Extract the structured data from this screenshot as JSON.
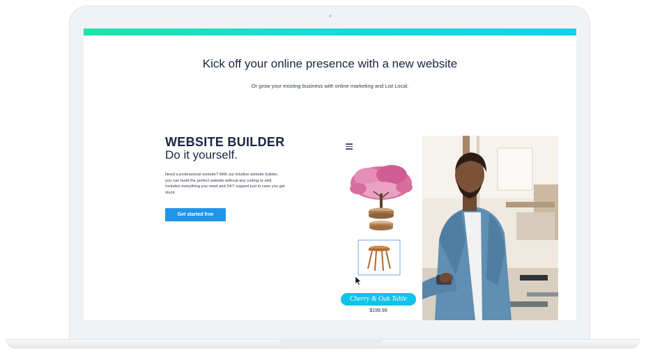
{
  "hero": {
    "headline": "Kick off your online presence with a new website",
    "subhead": "Or grow your existing business with online marketing and List Local."
  },
  "builder": {
    "title": "WEBSITE BUILDER",
    "subtitle": "Do it yourself.",
    "description": "Need a professional website? With our intuitive website builder, you can build the perfect website without any coding or skill. Includes everything you need and 24/7 support just in case you get stuck.",
    "cta_label": "Get started free"
  },
  "preview": {
    "menu_icon": "hamburger-menu-icon",
    "product_name": "Cherry & Oak Table",
    "product_price": "$199.99",
    "cursor_icon": "arrow-cursor-icon"
  },
  "colors": {
    "accent_gradient_start": "#1fe3a8",
    "accent_gradient_end": "#10d2ee",
    "button_blue": "#2196e8",
    "pill_cyan": "#10c3e8",
    "heading_navy": "#1a2542"
  }
}
